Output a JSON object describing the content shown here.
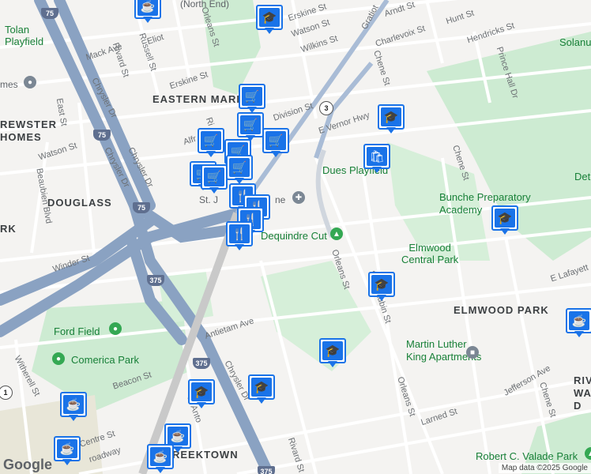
{
  "map": {
    "attribution": "Map data ©2025 Google",
    "logo": "Google",
    "colors": {
      "land": "#f4f3f1",
      "park": "#cdebd2",
      "freeway": "#8aa2c2",
      "road": "#ffffff",
      "marker": "#1a73e8"
    }
  },
  "labels": {
    "north_end": "(North End)",
    "tolan": "Tolan\nPlayfield",
    "homes": "mes",
    "brewster": "REWSTER\nHOMES",
    "eastern_market": "EASTERN MARK",
    "douglass": "DOUGLASS",
    "rk": "RK",
    "dues": "Dues Playfield",
    "bunche": "Bunche Preparatory\nAcademy",
    "dequindre": "Dequindre Cut",
    "elmwood_central": "Elmwood\nCentral Park",
    "elmwood_park": "ELMWOOD PARK",
    "mlk": "Martin Luther\nKing Apartments",
    "ford_field": "Ford Field",
    "comerica": "Comerica Park",
    "river": "RIVE\nWA\nD",
    "greektown": "REEKTOWN",
    "valade": "Robert C. Valade Park",
    "solanus": "Solanu",
    "detr": "Det",
    "st_j": "St. J",
    "ne": "ne",
    "e_vernor": "E Vernor Hwy",
    "e_lafayette": "E Lafayett",
    "gratiot": "Gratiot",
    "chene": "Chene St",
    "chene2": "Chene St",
    "chene3": "Chene St",
    "mack": "Mack Ave",
    "division": "Division St",
    "saint_aubin": "Saint Aubin St",
    "orleans": "Orleans St",
    "orleans2": "Orleans St",
    "orleans3": "Orleans St",
    "erskine": "Erskine St",
    "erskine2": "Erskine St",
    "watson": "Watson St",
    "watson2": "Watson St",
    "wilkins": "Wilkins St",
    "arndt": "Arndt St",
    "hunt": "Hunt St",
    "charlevoix": "Charlevoix St",
    "hendricks": "Hendricks St",
    "prince_hall": "Prince Hall Dr",
    "russell": "Russell St",
    "rivard": "Rivard St",
    "rivard2": "Rivard St",
    "eliot": "Eliot",
    "chrysler": "Chrysler Dr",
    "chrysler2": "Chrysler Dr",
    "chrysler3": "Chrysler Dr",
    "chrysler4": "Chrysler Dr",
    "east_st": "East St",
    "beaubien": "Beaubien Blvd",
    "winder": "Winder St",
    "antietam": "Antietam Ave",
    "beacon": "Beacon St",
    "witherell": "Witherell St",
    "centre": "Centre St",
    "broadway": "roadway",
    "st_antoine": "St Anto",
    "larned": "Larned St",
    "jefferson": "Jefferson Ave",
    "alfr": "Alfr",
    "ri": "Ri"
  },
  "shields": {
    "i75_top": "75",
    "i75_mid": "75",
    "i75_low": "75",
    "i375_a": "375",
    "i375_b": "375",
    "i375_c": "375",
    "m3": "3",
    "m1": "1"
  },
  "markers": [
    {
      "type": "cafe",
      "icon": "coffee-icon"
    },
    {
      "type": "school",
      "icon": "school-icon"
    },
    {
      "type": "grocery",
      "icon": "cart-icon"
    },
    {
      "type": "grocery",
      "icon": "cart-icon"
    },
    {
      "type": "grocery",
      "icon": "cart-icon"
    },
    {
      "type": "grocery",
      "icon": "cart-icon"
    },
    {
      "type": "grocery",
      "icon": "cart-icon"
    },
    {
      "type": "grocery",
      "icon": "cart-icon"
    },
    {
      "type": "grocery",
      "icon": "cart-icon"
    },
    {
      "type": "grocery",
      "icon": "cart-icon"
    },
    {
      "type": "restaurant",
      "icon": "utensils-icon"
    },
    {
      "type": "restaurant",
      "icon": "utensils-icon"
    },
    {
      "type": "restaurant",
      "icon": "utensils-icon"
    },
    {
      "type": "restaurant",
      "icon": "utensils-icon"
    },
    {
      "type": "school",
      "icon": "school-icon"
    },
    {
      "type": "shopping",
      "icon": "bag-icon"
    },
    {
      "type": "school",
      "icon": "school-icon"
    },
    {
      "type": "school",
      "icon": "school-icon"
    },
    {
      "type": "school",
      "icon": "school-icon"
    },
    {
      "type": "school",
      "icon": "school-icon"
    },
    {
      "type": "school",
      "icon": "school-icon"
    },
    {
      "type": "cafe",
      "icon": "coffee-icon"
    },
    {
      "type": "cafe",
      "icon": "coffee-icon"
    },
    {
      "type": "cafe",
      "icon": "coffee-icon"
    },
    {
      "type": "cafe",
      "icon": "coffee-icon"
    },
    {
      "type": "cafe",
      "icon": "coffee-icon"
    }
  ]
}
